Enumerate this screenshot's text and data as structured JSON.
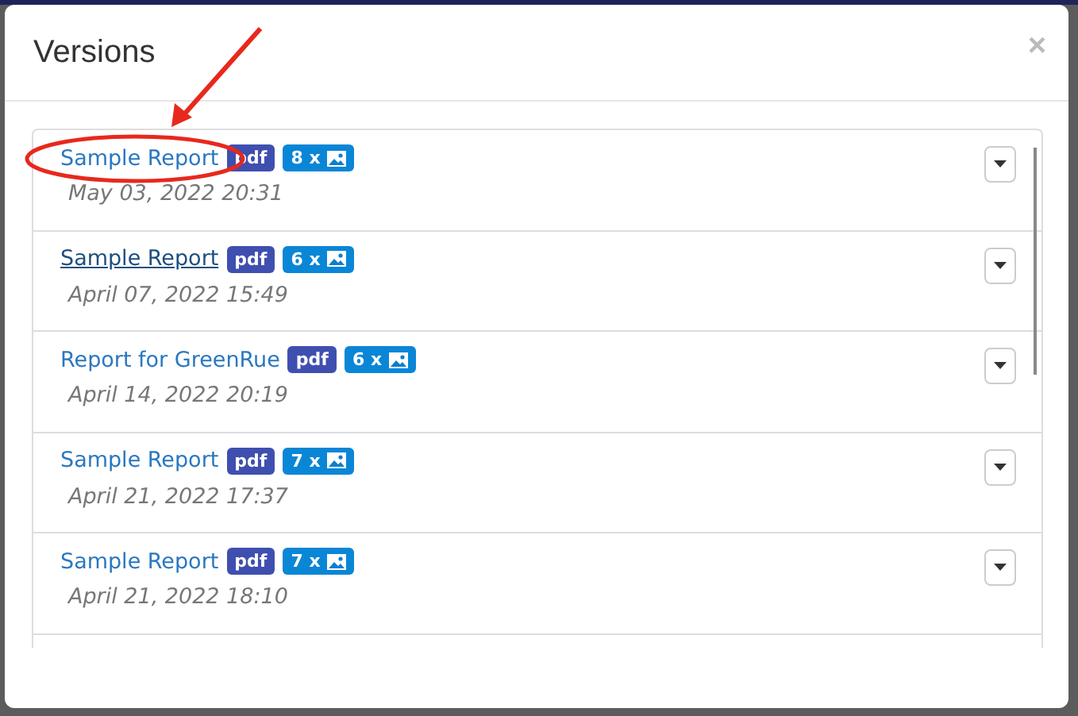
{
  "dialog": {
    "title": "Versions",
    "close": "×"
  },
  "versions": [
    {
      "title": "Sample Report",
      "date": "May 03, 2022 20:31",
      "format": "pdf",
      "images": "8 x",
      "hovered": false
    },
    {
      "title": "Sample Report",
      "date": "April 07, 2022 15:49",
      "format": "pdf",
      "images": "6 x",
      "hovered": true
    },
    {
      "title": "Report for GreenRue",
      "date": "April 14, 2022 20:19",
      "format": "pdf",
      "images": "6 x",
      "hovered": false
    },
    {
      "title": "Sample Report",
      "date": "April 21, 2022 17:37",
      "format": "pdf",
      "images": "7 x",
      "hovered": false
    },
    {
      "title": "Sample Report",
      "date": "April 21, 2022 18:10",
      "format": "pdf",
      "images": "7 x",
      "hovered": false
    }
  ]
}
